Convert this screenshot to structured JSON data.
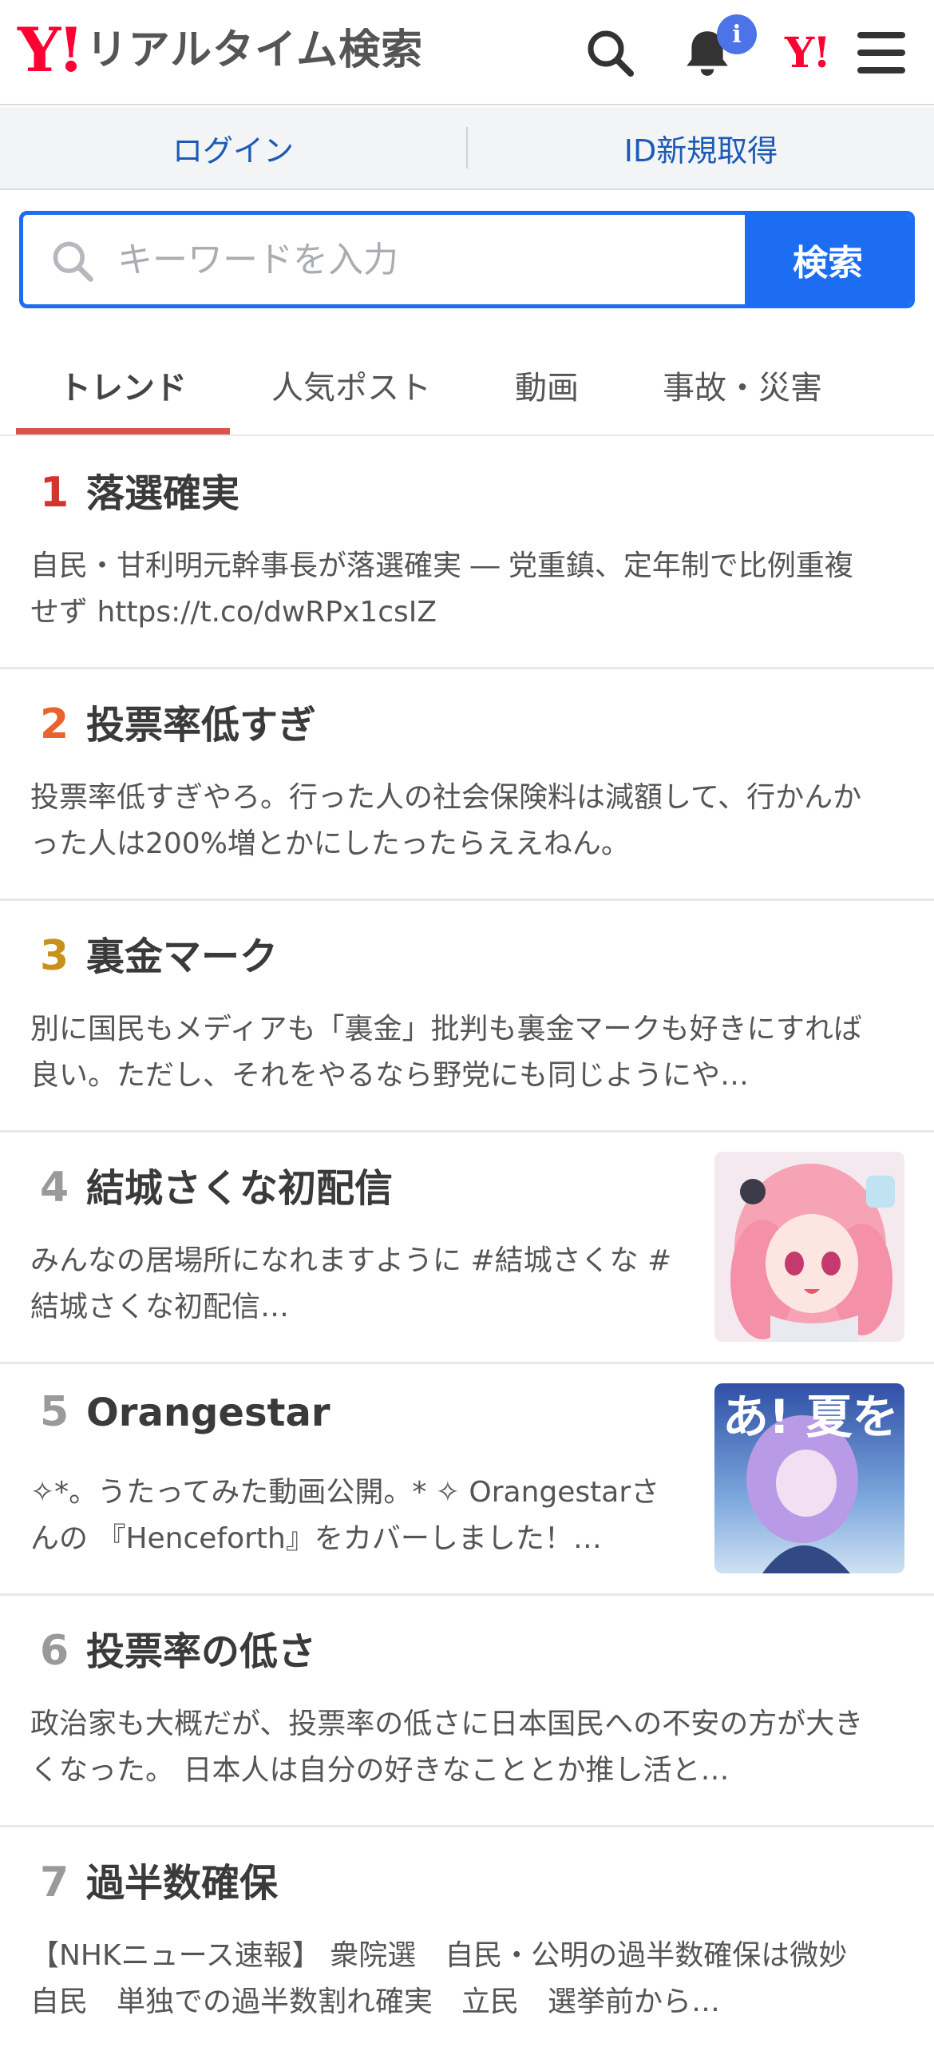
{
  "header": {
    "logo_y": "Y!",
    "logo_text": "リアルタイム検索",
    "notification_badge": "i",
    "yj_mark": "Y!",
    "icons": [
      "search-icon",
      "bell-icon",
      "menu-icon"
    ]
  },
  "auth": {
    "login": "ログイン",
    "register": "ID新規取得"
  },
  "search": {
    "placeholder": "キーワードを入力",
    "value": "",
    "button": "検索"
  },
  "tabs": [
    {
      "label": "トレンド",
      "active": true
    },
    {
      "label": "人気ポスト",
      "active": false
    },
    {
      "label": "動画",
      "active": false
    },
    {
      "label": "事故・災害",
      "active": false
    }
  ],
  "colors": {
    "brand": "#ff0033",
    "accent": "#1d6df2",
    "tab_underline": "#d9534f",
    "rank1": "#d0352f",
    "rank2": "#e8642c",
    "rank3": "#c8921a",
    "rank_other": "#9a9a9a"
  },
  "trends": [
    {
      "rank": "1",
      "term": "落選確実",
      "snippet": "自民・甘利明元幹事長が落選確実 ― 党重鎮、定年制で比例重複せず https://t.co/dwRPx1csIZ",
      "thumb": false
    },
    {
      "rank": "2",
      "term": "投票率低すぎ",
      "snippet": "投票率低すぎやろ。行った人の社会保険料は減額して、行かんかった人は200%増とかにしたったらええねん。",
      "thumb": false
    },
    {
      "rank": "3",
      "term": "裏金マーク",
      "snippet": "別に国民もメディアも「裏金」批判も裏金マークも好きにすれば良い。ただし、それをやるなら野党にも同じようにや…",
      "thumb": false
    },
    {
      "rank": "4",
      "term": "結城さくな初配信",
      "snippet": "みんなの居場所になれますように #結城さくな #結城さくな初配信…",
      "thumb": true
    },
    {
      "rank": "5",
      "term": "Orangestar",
      "snippet": "✧*。うたってみた動画公開。* ✧ Orangestarさんの 『Henceforth』をカバーしました！…",
      "thumb": true
    },
    {
      "rank": "6",
      "term": "投票率の低さ",
      "snippet": "政治家も大概だが、投票率の低さに日本国民への不安の方が大きくなった。 日本人は自分の好きなこととか推し活と…",
      "thumb": false
    },
    {
      "rank": "7",
      "term": "過半数確保",
      "snippet": "【NHKニュース速報】 衆院選　自民・公明の過半数確保は微妙　自民　単独での過半数割れ確実　立民　選挙前から…",
      "thumb": false
    }
  ],
  "thumb5_text": "あ! 夏をこうも"
}
